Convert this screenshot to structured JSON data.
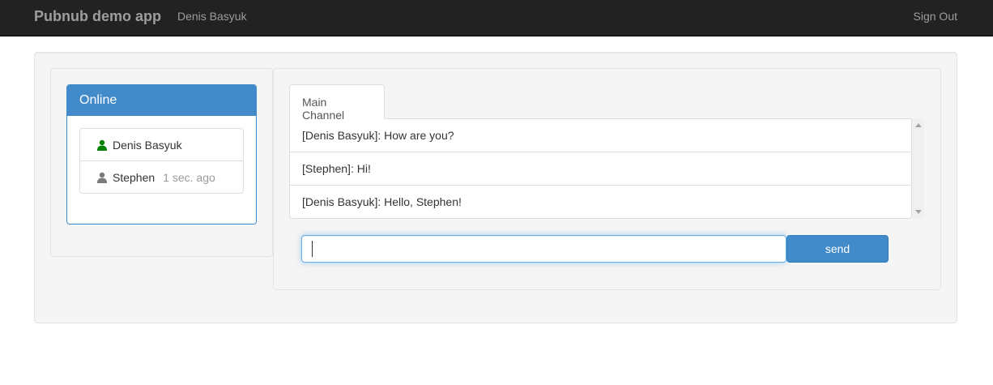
{
  "navbar": {
    "brand": "Pubnub demo app",
    "user": "Denis Basyuk",
    "signout": "Sign Out"
  },
  "online_panel": {
    "title": "Online",
    "users": [
      {
        "name": "Denis Basyuk",
        "meta": "",
        "icon": "user-icon",
        "color": "#008000"
      },
      {
        "name": "Stephen",
        "meta": "1 sec. ago",
        "icon": "user-icon",
        "color": "#7a7a7a"
      }
    ]
  },
  "chat": {
    "tab_label": "Main Channel",
    "messages": [
      "[Denis Basyuk]: How are you?",
      "[Stephen]: Hi!",
      "[Denis Basyuk]: Hello, Stephen!"
    ],
    "input_value": "",
    "send_label": "send"
  },
  "colors": {
    "primary": "#428bca",
    "navbar": "#222222",
    "online": "#008000",
    "away": "#7a7a7a"
  }
}
